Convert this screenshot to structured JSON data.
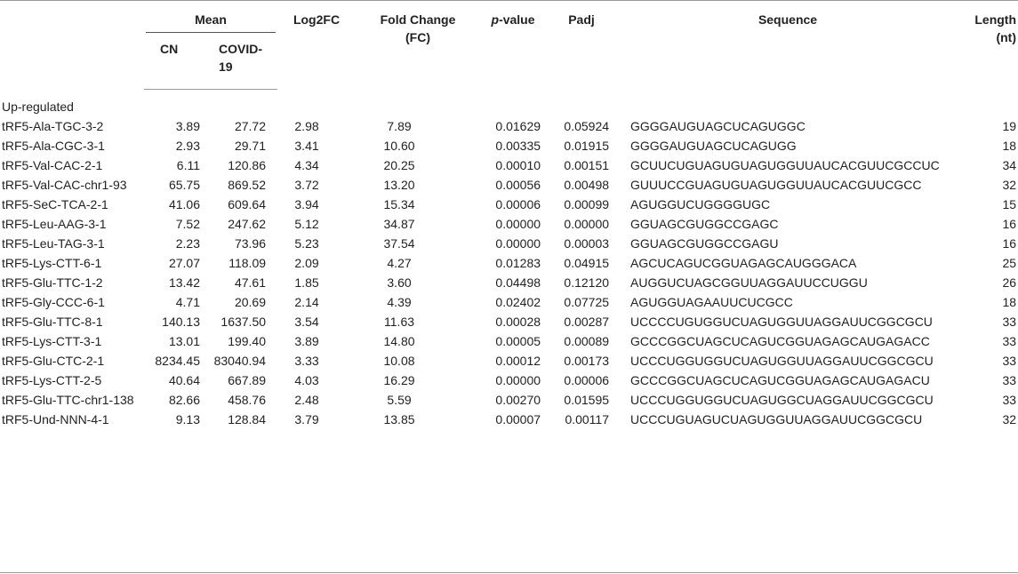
{
  "table": {
    "headers": {
      "mean": "Mean",
      "cn": "CN",
      "covid": "COVID-19",
      "log2fc": "Log2FC",
      "fold_change": "Fold Change (FC)",
      "pvalue_italic": "p",
      "pvalue_rest": "-value",
      "padj": "Padj",
      "sequence": "Sequence",
      "length": "Length (nt)"
    },
    "section_label": "Up-regulated",
    "rows": [
      {
        "id": "tRF5-Ala-TGC-3-2",
        "cn": "3.89",
        "covid": "27.72",
        "log2fc": "2.98",
        "fc": "7.89",
        "pvalue": "0.01629",
        "padj": "0.05924",
        "sequence": "GGGGAUGUAGCUCAGUGGC",
        "length": "19"
      },
      {
        "id": "tRF5-Ala-CGC-3-1",
        "cn": "2.93",
        "covid": "29.71",
        "log2fc": "3.41",
        "fc": "10.60",
        "pvalue": "0.00335",
        "padj": "0.01915",
        "sequence": "GGGGAUGUAGCUCAGUGG",
        "length": "18"
      },
      {
        "id": "tRF5-Val-CAC-2-1",
        "cn": "6.11",
        "covid": "120.86",
        "log2fc": "4.34",
        "fc": "20.25",
        "pvalue": "0.00010",
        "padj": "0.00151",
        "sequence": "GCUUCUGUAGUGUAGUGGUUAUCACGUUCGCCUC",
        "length": "34"
      },
      {
        "id": "tRF5-Val-CAC-chr1-93",
        "cn": "65.75",
        "covid": "869.52",
        "log2fc": "3.72",
        "fc": "13.20",
        "pvalue": "0.00056",
        "padj": "0.00498",
        "sequence": "GUUUCCGUAGUGUAGUGGUUAUCACGUUCGCC",
        "length": "32"
      },
      {
        "id": "tRF5-SeC-TCA-2-1",
        "cn": "41.06",
        "covid": "609.64",
        "log2fc": "3.94",
        "fc": "15.34",
        "pvalue": "0.00006",
        "padj": "0.00099",
        "sequence": "AGUGGUCUGGGGUGC",
        "length": "15"
      },
      {
        "id": "tRF5-Leu-AAG-3-1",
        "cn": "7.52",
        "covid": "247.62",
        "log2fc": "5.12",
        "fc": "34.87",
        "pvalue": "0.00000",
        "padj": "0.00000",
        "sequence": "GGUAGCGUGGCCGAGC",
        "length": "16"
      },
      {
        "id": "tRF5-Leu-TAG-3-1",
        "cn": "2.23",
        "covid": "73.96",
        "log2fc": "5.23",
        "fc": "37.54",
        "pvalue": "0.00000",
        "padj": "0.00003",
        "sequence": "GGUAGCGUGGCCGAGU",
        "length": "16"
      },
      {
        "id": "tRF5-Lys-CTT-6-1",
        "cn": "27.07",
        "covid": "118.09",
        "log2fc": "2.09",
        "fc": "4.27",
        "pvalue": "0.01283",
        "padj": "0.04915",
        "sequence": "AGCUCAGUCGGUAGAGCAUGGGACA",
        "length": "25"
      },
      {
        "id": "tRF5-Glu-TTC-1-2",
        "cn": "13.42",
        "covid": "47.61",
        "log2fc": "1.85",
        "fc": "3.60",
        "pvalue": "0.04498",
        "padj": "0.12120",
        "sequence": "AUGGUCUAGCGGUUAGGAUUCCUGGU",
        "length": "26"
      },
      {
        "id": "tRF5-Gly-CCC-6-1",
        "cn": "4.71",
        "covid": "20.69",
        "log2fc": "2.14",
        "fc": "4.39",
        "pvalue": "0.02402",
        "padj": "0.07725",
        "sequence": "AGUGGUAGAAUUCUCGCC",
        "length": "18"
      },
      {
        "id": "tRF5-Glu-TTC-8-1",
        "cn": "140.13",
        "covid": "1637.50",
        "log2fc": "3.54",
        "fc": "11.63",
        "pvalue": "0.00028",
        "padj": "0.00287",
        "sequence": "UCCCCUGUGGUCUAGUGGUUAGGAUUCGGCGCU",
        "length": "33"
      },
      {
        "id": "tRF5-Lys-CTT-3-1",
        "cn": "13.01",
        "covid": "199.40",
        "log2fc": "3.89",
        "fc": "14.80",
        "pvalue": "0.00005",
        "padj": "0.00089",
        "sequence": "GCCCGGCUAGCUCAGUCGGUAGAGCAUGAGACC",
        "length": "33"
      },
      {
        "id": "tRF5-Glu-CTC-2-1",
        "cn": "8234.45",
        "covid": "83040.94",
        "log2fc": "3.33",
        "fc": "10.08",
        "pvalue": "0.00012",
        "padj": "0.00173",
        "sequence": "UCCCUGGUGGUCUAGUGGUUAGGAUUCGGCGCU",
        "length": "33"
      },
      {
        "id": "tRF5-Lys-CTT-2-5",
        "cn": "40.64",
        "covid": "667.89",
        "log2fc": "4.03",
        "fc": "16.29",
        "pvalue": "0.00000",
        "padj": "0.00006",
        "sequence": "GCCCGGCUAGCUCAGUCGGUAGAGCAUGAGACU",
        "length": "33"
      },
      {
        "id": "tRF5-Glu-TTC-chr1-138",
        "cn": "82.66",
        "covid": "458.76",
        "log2fc": "2.48",
        "fc": "5.59",
        "pvalue": "0.00270",
        "padj": "0.01595",
        "sequence": "UCCCUGGUGGUCUAGUGGCUAGGAUUCGGCGCU",
        "length": "33"
      },
      {
        "id": "tRF5-Und-NNN-4-1",
        "cn": "9.13",
        "covid": "128.84",
        "log2fc": "3.79",
        "fc": "13.85",
        "pvalue": "0.00007",
        "padj": "0.00117",
        "sequence": "UCCCUGUAGUCUAGUGGUUAGGAUUCGGCGCU",
        "length": "32"
      }
    ]
  }
}
